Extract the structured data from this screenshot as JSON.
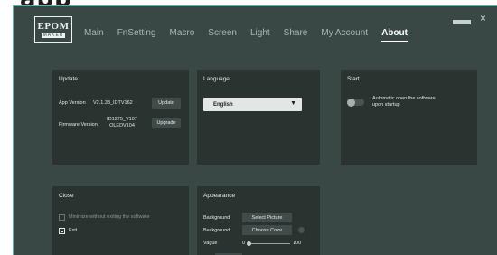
{
  "background_text": "app",
  "app": {
    "logo_main": "EPOM",
    "logo_sub": "MAKER"
  },
  "nav": {
    "items": [
      "Main",
      "FnSetting",
      "Macro",
      "Screen",
      "Light",
      "Share",
      "My Account",
      "About"
    ],
    "active": "About"
  },
  "window_controls": {
    "close": "×"
  },
  "update": {
    "title": "Update",
    "app_version_label": "App Version",
    "app_version_value": "V2.1.33_IDTV162",
    "update_button": "Update",
    "firmware_version_label": "Firmware Version",
    "firmware_version_line1": "ID1275_V107",
    "firmware_version_line2": "OLEDV104",
    "upgrade_button": "Upgrade"
  },
  "language": {
    "title": "Language",
    "selected": "English",
    "caret": "▼"
  },
  "start": {
    "title": "Start",
    "autostart_label_line1": "Automatic open the software",
    "autostart_label_line2": "upon startup",
    "autostart_enabled": false
  },
  "close": {
    "title": "Close",
    "option_minimize": "Minimize without exiting the software",
    "option_exit": "Exit",
    "selected": "Exit"
  },
  "appearance": {
    "title": "Appearance",
    "background_label_1": "Background",
    "select_picture_button": "Select Picture",
    "background_label_2": "Background",
    "choose_color_button": "Choose Color",
    "vague_label": "Vague",
    "vague_min": "0",
    "vague_max": "100",
    "vague_value": 0
  },
  "colors": {
    "accent": "#4fb8a6",
    "window_bg": "#3a4845",
    "panel_bg": "#2b3331"
  }
}
